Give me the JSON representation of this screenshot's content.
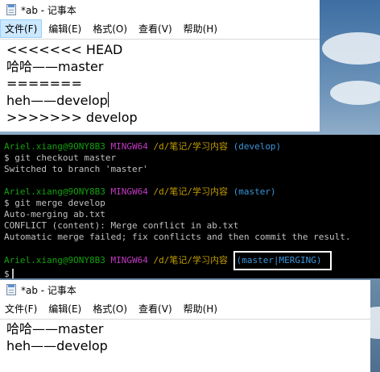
{
  "notepad_top": {
    "title": "*ab - 记事本",
    "menu": [
      "文件(F)",
      "编辑(E)",
      "格式(O)",
      "查看(V)",
      "帮助(H)"
    ],
    "lines": [
      "<<<<<<< HEAD",
      "哈哈——master",
      "=======",
      "heh——develop",
      ">>>>>>> develop"
    ]
  },
  "terminal": {
    "lines": [
      {
        "user": "Ariel.xiang@9ONY8B3",
        "host": "MINGW64",
        "path": "/d/笔记/学习内容",
        "branch": "(develop)"
      },
      {
        "text": "$ git checkout master"
      },
      {
        "text": "Switched to branch 'master'"
      },
      {
        "text": ""
      },
      {
        "user": "Ariel.xiang@9ONY8B3",
        "host": "MINGW64",
        "path": "/d/笔记/学习内容",
        "branch": "(master)"
      },
      {
        "text": "$ git merge develop"
      },
      {
        "text": "Auto-merging ab.txt"
      },
      {
        "text": "CONFLICT (content): Merge conflict in ab.txt"
      },
      {
        "text": "Automatic merge failed; fix conflicts and then commit the result."
      },
      {
        "text": ""
      },
      {
        "user": "Ariel.xiang@9ONY8B3",
        "host": "MINGW64",
        "path": "/d/笔记/学习内容",
        "branch": "(master|MERGING)"
      },
      {
        "text": "$"
      }
    ]
  },
  "notepad_bottom": {
    "title": "*ab - 记事本",
    "menu": [
      "文件(F)",
      "编辑(E)",
      "格式(O)",
      "查看(V)",
      "帮助(H)"
    ],
    "lines": [
      "哈哈——master",
      "heh——develop"
    ]
  },
  "colors": {
    "prompt_user": "#13a10e",
    "prompt_host": "#c239c2",
    "prompt_path": "#c19c00",
    "prompt_branch": "#3a96dd",
    "menu_active": "#cce8ff"
  }
}
